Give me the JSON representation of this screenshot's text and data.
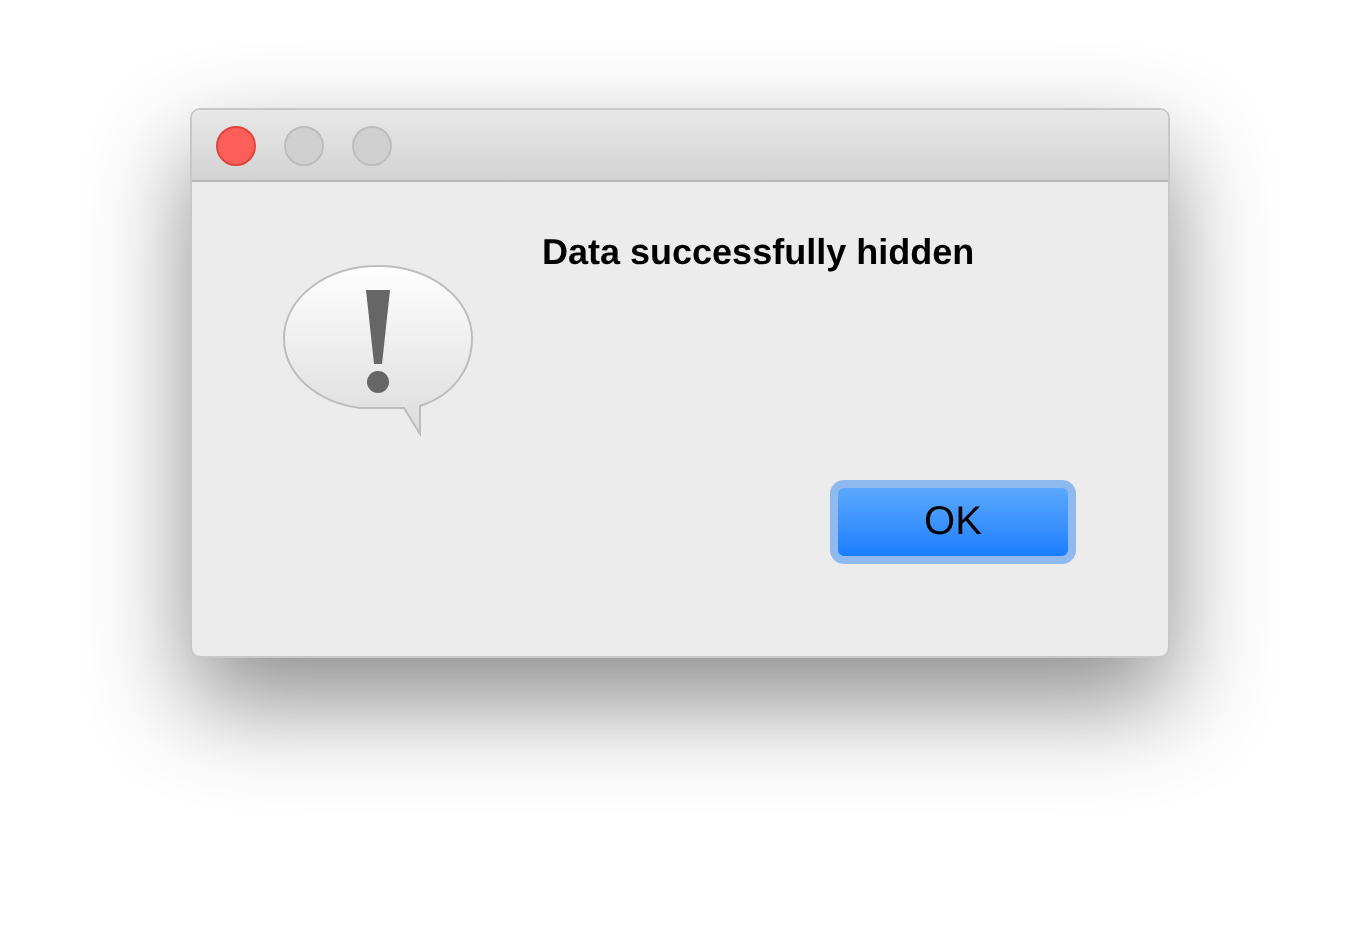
{
  "message": "Data successfully hidden",
  "buttons": [
    {
      "label": "OK",
      "default": true
    }
  ]
}
